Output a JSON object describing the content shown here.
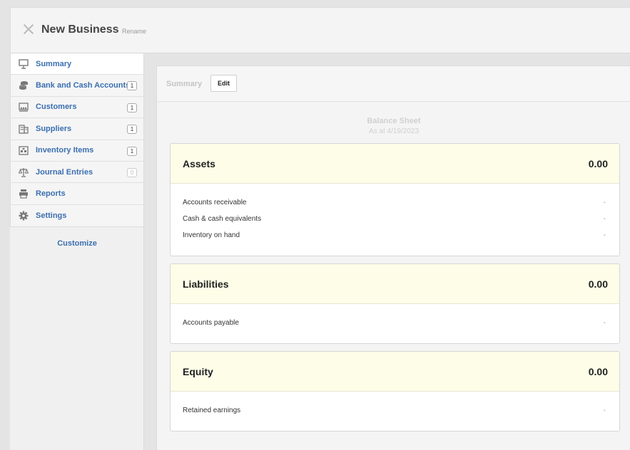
{
  "header": {
    "title": "New Business",
    "rename_label": "Rename"
  },
  "sidebar": {
    "items": [
      {
        "label": "Summary",
        "icon": "presentation-icon",
        "count": null,
        "active": true
      },
      {
        "label": "Bank and Cash Accounts",
        "icon": "coins-icon",
        "count": "1",
        "active": false
      },
      {
        "label": "Customers",
        "icon": "customers-icon",
        "count": "1",
        "active": false
      },
      {
        "label": "Suppliers",
        "icon": "building-icon",
        "count": "1",
        "active": false
      },
      {
        "label": "Inventory Items",
        "icon": "warehouse-icon",
        "count": "1",
        "active": false
      },
      {
        "label": "Journal Entries",
        "icon": "scales-icon",
        "count": "0",
        "active": false
      },
      {
        "label": "Reports",
        "icon": "printer-icon",
        "count": null,
        "active": false
      },
      {
        "label": "Settings",
        "icon": "gear-icon",
        "count": null,
        "active": false
      }
    ],
    "customize_label": "Customize"
  },
  "content": {
    "breadcrumb": "Summary",
    "edit_label": "Edit",
    "report_title": "Balance Sheet",
    "report_subtitle": "As at 4/19/2023",
    "sections": [
      {
        "title": "Assets",
        "total": "0.00",
        "lines": [
          {
            "label": "Accounts receivable",
            "value": "-"
          },
          {
            "label": "Cash & cash equivalents",
            "value": "-"
          },
          {
            "label": "Inventory on hand",
            "value": "-"
          }
        ]
      },
      {
        "title": "Liabilities",
        "total": "0.00",
        "lines": [
          {
            "label": "Accounts payable",
            "value": "-"
          }
        ]
      },
      {
        "title": "Equity",
        "total": "0.00",
        "lines": [
          {
            "label": "Retained earnings",
            "value": "-"
          }
        ]
      }
    ]
  },
  "colors": {
    "link": "#3a6fb0",
    "card_header": "#fdfde8",
    "muted": "#d0d0d0"
  }
}
